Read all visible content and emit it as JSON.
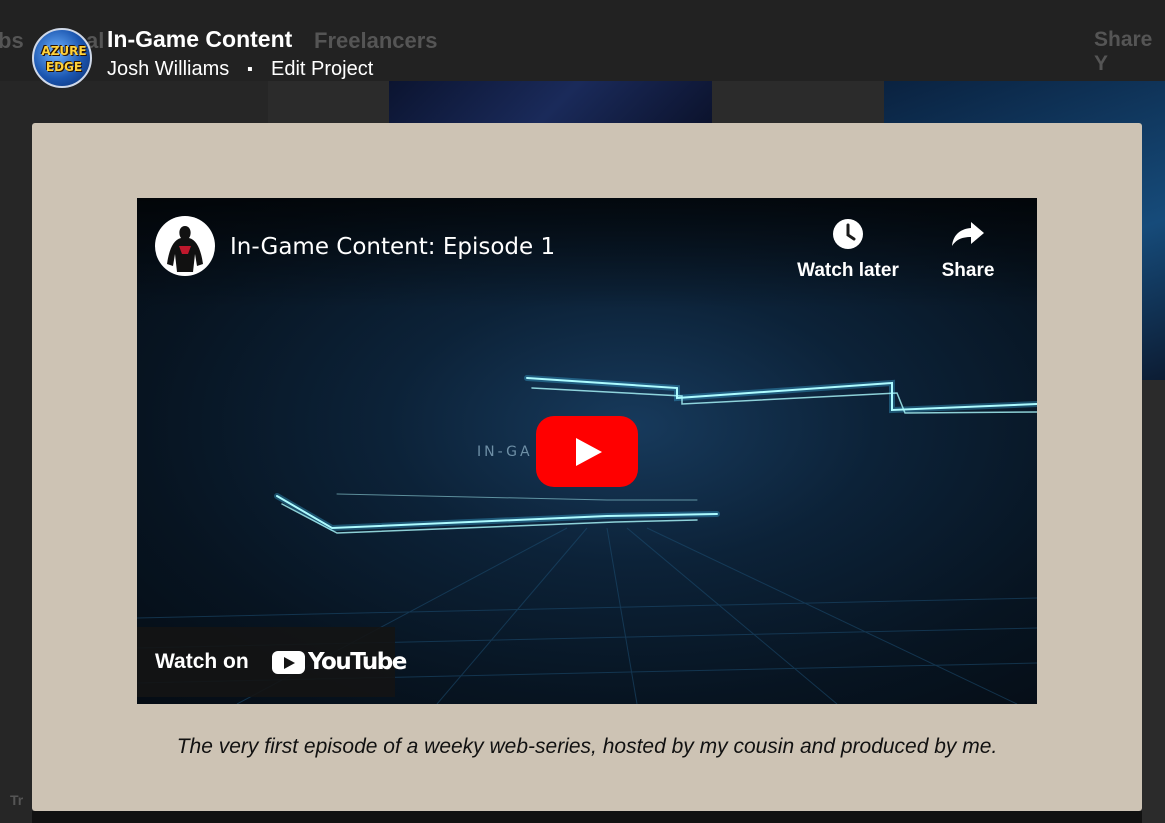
{
  "background": {
    "nav_fragment_left": "bs",
    "nav_fragment_mid": "al",
    "nav_freelancers": "Freelancers",
    "share_fragment": "Share Y",
    "bottom_fragment": "Tr"
  },
  "header": {
    "logo_text_top": "AZURE",
    "logo_text_bottom": "EDGE",
    "title": "In-Game Content",
    "author": "Josh Williams",
    "separator": "▪",
    "edit_link": "Edit Project"
  },
  "video": {
    "title": "In-Game Content: Episode 1",
    "watch_later": "Watch later",
    "share": "Share",
    "watch_on": "Watch on",
    "youtube_word": "YouTube",
    "scene_text": "IN-GA    TENT",
    "play_color": "#ff0000"
  },
  "caption": "The very first episode of a weeky web-series, hosted by my cousin and produced by me.",
  "colors": {
    "modal_bg": "#cdc3b4",
    "page_bg": "#2b2b2b",
    "glow": "#7ff7ff"
  }
}
